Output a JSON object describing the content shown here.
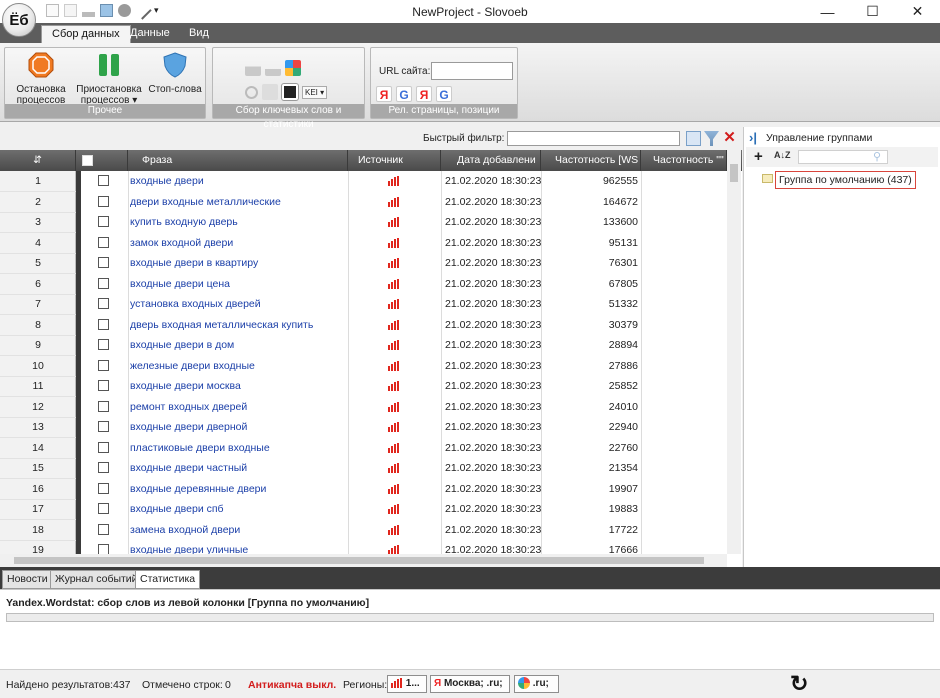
{
  "app": {
    "title": "NewProject - Slovoeb",
    "logo": "Ёб",
    "window_buttons": {
      "minimize": "—",
      "maximize": "☐",
      "close": "✕"
    }
  },
  "ribbon": {
    "tabs": [
      "Сбор данных",
      "Данные",
      "Вид"
    ],
    "groups": {
      "other": {
        "label": "Прочее",
        "buttons": [
          {
            "label1": "Остановка",
            "label2": "процессов ▾"
          },
          {
            "label1": "Приостановка",
            "label2": "процессов ▾"
          },
          {
            "label1": "Стоп-слова",
            "label2": ""
          }
        ]
      },
      "keywords": {
        "label": "Сбор ключевых слов и статистики",
        "kei_label": "KEI ▾"
      },
      "relevant": {
        "label": "Рел. страницы, позиции",
        "url_label": "URL сайта:",
        "url_value": ""
      }
    }
  },
  "filter": {
    "label": "Быстрый фильтр:",
    "value": ""
  },
  "grid": {
    "headers": {
      "num": "⇵",
      "phrase": "Фраза",
      "source": "Источник",
      "date": "Дата добавлени",
      "freq_ws": "Частотность [WS",
      "freq2": "Частотность \"\""
    },
    "rows": [
      {
        "num": "1",
        "phrase": "входные двери",
        "date": "21.02.2020 18:30:23",
        "freq": "962555"
      },
      {
        "num": "2",
        "phrase": "двери входные металлические",
        "date": "21.02.2020 18:30:23",
        "freq": "164672"
      },
      {
        "num": "3",
        "phrase": "купить входную дверь",
        "date": "21.02.2020 18:30:23",
        "freq": "133600"
      },
      {
        "num": "4",
        "phrase": "замок входной двери",
        "date": "21.02.2020 18:30:23",
        "freq": "95131"
      },
      {
        "num": "5",
        "phrase": "входные двери в квартиру",
        "date": "21.02.2020 18:30:23",
        "freq": "76301"
      },
      {
        "num": "6",
        "phrase": "входные двери цена",
        "date": "21.02.2020 18:30:23",
        "freq": "67805"
      },
      {
        "num": "7",
        "phrase": "установка входных дверей",
        "date": "21.02.2020 18:30:23",
        "freq": "51332"
      },
      {
        "num": "8",
        "phrase": "дверь входная металлическая купить",
        "date": "21.02.2020 18:30:23",
        "freq": "30379"
      },
      {
        "num": "9",
        "phrase": "входные двери в дом",
        "date": "21.02.2020 18:30:23",
        "freq": "28894"
      },
      {
        "num": "10",
        "phrase": "железные двери входные",
        "date": "21.02.2020 18:30:23",
        "freq": "27886"
      },
      {
        "num": "11",
        "phrase": "входные двери москва",
        "date": "21.02.2020 18:30:23",
        "freq": "25852"
      },
      {
        "num": "12",
        "phrase": "ремонт входных дверей",
        "date": "21.02.2020 18:30:23",
        "freq": "24010"
      },
      {
        "num": "13",
        "phrase": "входные двери дверной",
        "date": "21.02.2020 18:30:23",
        "freq": "22940"
      },
      {
        "num": "14",
        "phrase": "пластиковые двери входные",
        "date": "21.02.2020 18:30:23",
        "freq": "22760"
      },
      {
        "num": "15",
        "phrase": "входные двери частный",
        "date": "21.02.2020 18:30:23",
        "freq": "21354"
      },
      {
        "num": "16",
        "phrase": "входные деревянные двери",
        "date": "21.02.2020 18:30:23",
        "freq": "19907"
      },
      {
        "num": "17",
        "phrase": "входные двери спб",
        "date": "21.02.2020 18:30:23",
        "freq": "19883"
      },
      {
        "num": "18",
        "phrase": "замена входной двери",
        "date": "21.02.2020 18:30:23",
        "freq": "17722"
      },
      {
        "num": "19",
        "phrase": "входные двери уличные",
        "date": "21.02.2020 18:30:23",
        "freq": "17666"
      }
    ]
  },
  "group_panel": {
    "title": "Управление группами",
    "groups": [
      "Группа по умолчанию (437)"
    ]
  },
  "bottom_tabs": [
    "Новости",
    "Журнал событий",
    "Статистика"
  ],
  "stats": {
    "text": "Yandex.Wordstat: сбор слов из левой колонки [Группа по умолчанию]"
  },
  "statusbar": {
    "found_label": "Найдено результатов:",
    "found_value": "437",
    "marked_label": "Отмечено строк:",
    "marked_value": "0",
    "anticaptcha": "Антикапча выкл.",
    "regions_label": "Регионы:",
    "region_box1": "1...",
    "region_box2": "Москва; .ru;",
    "region_box3": ".ru;"
  },
  "colors": {
    "accent_red": "#d21c1c",
    "link_blue": "#1b3fa8",
    "ribbon_dark": "#5d5d5d"
  }
}
